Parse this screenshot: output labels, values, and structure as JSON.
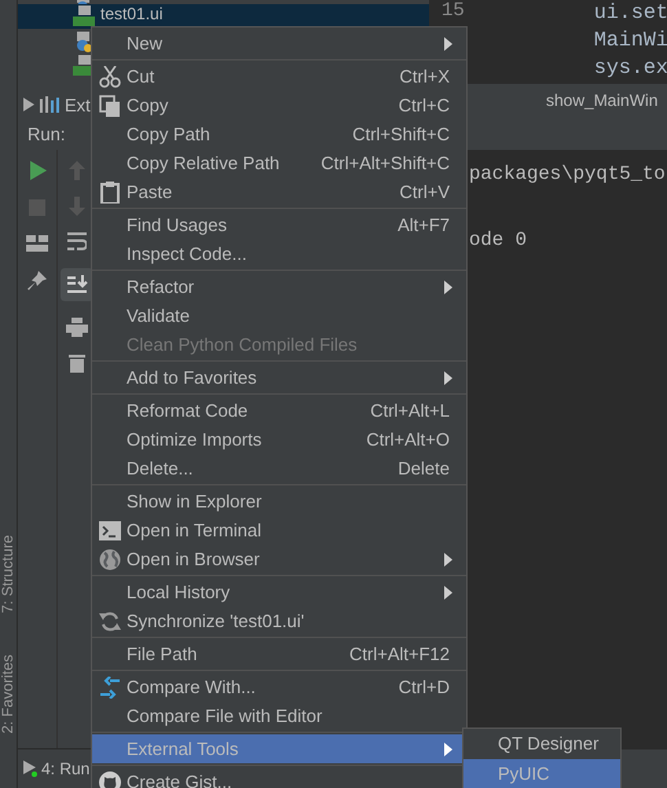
{
  "project_tree": {
    "rows": [
      {
        "kind": "python",
        "selected": false
      },
      {
        "kind": "qt",
        "label": "test01.ui",
        "selected": true
      },
      {
        "kind": "python",
        "selected": false
      },
      {
        "kind": "qt",
        "selected": false
      }
    ],
    "libraries": {
      "label": "Ext"
    }
  },
  "editor": {
    "line_number": "15",
    "lines": [
      "ui.set",
      "MainWi",
      "sys.ex"
    ],
    "tab": "show_MainWin"
  },
  "run_panel": {
    "title": "Run:",
    "console": [
      "packages\\pyqt5_to",
      "ode 0"
    ]
  },
  "left_bar": [
    "7: Structure",
    "2: Favorites"
  ],
  "bottom_bar": {
    "tab": "4: Run"
  },
  "context_menu": [
    {
      "kind": "plain",
      "label": "New",
      "submenu": true,
      "disabled": false,
      "selected": false
    },
    {
      "kind": "separator"
    },
    {
      "kind": "scissors",
      "label": "Cut",
      "shortcut": "Ctrl+X",
      "disabled": false,
      "selected": false
    },
    {
      "kind": "copy",
      "label": "Copy",
      "shortcut": "Ctrl+C",
      "disabled": false,
      "selected": false
    },
    {
      "kind": "plain",
      "label": "Copy Path",
      "shortcut": "Ctrl+Shift+C",
      "disabled": false,
      "selected": false
    },
    {
      "kind": "plain",
      "label": "Copy Relative Path",
      "shortcut": "Ctrl+Alt+Shift+C",
      "disabled": false,
      "selected": false
    },
    {
      "kind": "clipboard",
      "label": "Paste",
      "shortcut": "Ctrl+V",
      "disabled": false,
      "selected": false
    },
    {
      "kind": "separator"
    },
    {
      "kind": "plain",
      "label": "Find Usages",
      "shortcut": "Alt+F7",
      "disabled": false,
      "selected": false
    },
    {
      "kind": "plain",
      "label": "Inspect Code...",
      "disabled": false,
      "selected": false
    },
    {
      "kind": "separator"
    },
    {
      "kind": "plain",
      "label": "Refactor",
      "submenu": true,
      "disabled": false,
      "selected": false
    },
    {
      "kind": "plain",
      "label": "Validate",
      "disabled": false,
      "selected": false
    },
    {
      "kind": "plain",
      "label": "Clean Python Compiled Files",
      "disabled": true,
      "selected": false
    },
    {
      "kind": "separator"
    },
    {
      "kind": "plain",
      "label": "Add to Favorites",
      "submenu": true,
      "disabled": false,
      "selected": false
    },
    {
      "kind": "separator"
    },
    {
      "kind": "plain",
      "label": "Reformat Code",
      "shortcut": "Ctrl+Alt+L",
      "disabled": false,
      "selected": false
    },
    {
      "kind": "plain",
      "label": "Optimize Imports",
      "shortcut": "Ctrl+Alt+O",
      "disabled": false,
      "selected": false
    },
    {
      "kind": "plain",
      "label": "Delete...",
      "shortcut": "Delete",
      "disabled": false,
      "selected": false
    },
    {
      "kind": "separator"
    },
    {
      "kind": "plain",
      "label": "Show in Explorer",
      "disabled": false,
      "selected": false
    },
    {
      "kind": "terminal",
      "label": "Open in Terminal",
      "disabled": false,
      "selected": false
    },
    {
      "kind": "globe",
      "label": "Open in Browser",
      "submenu": true,
      "disabled": false,
      "selected": false
    },
    {
      "kind": "separator"
    },
    {
      "kind": "plain",
      "label": "Local History",
      "submenu": true,
      "disabled": false,
      "selected": false
    },
    {
      "kind": "sync",
      "label": "Synchronize 'test01.ui'",
      "disabled": false,
      "selected": false
    },
    {
      "kind": "separator"
    },
    {
      "kind": "plain",
      "label": "File Path",
      "shortcut": "Ctrl+Alt+F12",
      "disabled": false,
      "selected": false
    },
    {
      "kind": "separator"
    },
    {
      "kind": "compare",
      "label": "Compare With...",
      "shortcut": "Ctrl+D",
      "disabled": false,
      "selected": false
    },
    {
      "kind": "plain",
      "label": "Compare File with Editor",
      "disabled": false,
      "selected": false
    },
    {
      "kind": "separator"
    },
    {
      "kind": "plain",
      "label": "External Tools",
      "submenu": true,
      "disabled": false,
      "selected": true
    },
    {
      "kind": "separator"
    },
    {
      "kind": "github",
      "label": "Create Gist...",
      "disabled": false,
      "selected": false
    }
  ],
  "submenu": [
    {
      "label": "QT Designer",
      "selected": false
    },
    {
      "label": "PyUIC",
      "selected": true
    }
  ]
}
